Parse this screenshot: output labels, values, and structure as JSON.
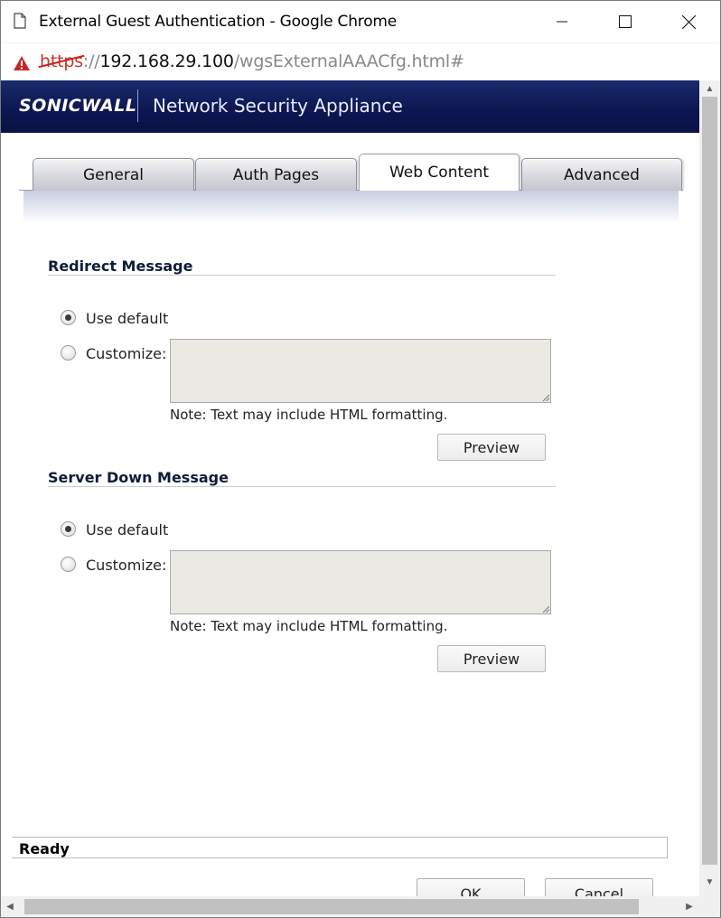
{
  "window": {
    "title": "External Guest Authentication - Google Chrome",
    "controls": [
      "minimize",
      "maximize",
      "close"
    ]
  },
  "address": {
    "scheme": "https",
    "separator": "://",
    "host": "192.168.29.100",
    "path": "/wgsExternalAAACfg.html#",
    "security_state": "not-secure-warning"
  },
  "banner": {
    "logo": "SONICWALL",
    "product": "Network Security Appliance",
    "colors": {
      "banner_bg": "#0c1650",
      "title_text": "#0e1c3a"
    }
  },
  "tabs": [
    {
      "label": "General",
      "active": false
    },
    {
      "label": "Auth Pages",
      "active": false
    },
    {
      "label": "Web Content",
      "active": true
    },
    {
      "label": "Advanced",
      "active": false
    }
  ],
  "redirect": {
    "title": "Redirect Message",
    "option_default": "Use default",
    "option_custom": "Customize:",
    "selected": "default",
    "custom_value": "",
    "note": "Note: Text may include HTML formatting.",
    "preview_label": "Preview"
  },
  "server_down": {
    "title": "Server Down Message",
    "option_default": "Use default",
    "option_custom": "Customize:",
    "selected": "default",
    "custom_value": "",
    "note": "Note: Text may include HTML formatting.",
    "preview_label": "Preview"
  },
  "status": {
    "text": "Ready"
  },
  "footer": {
    "ok_label": "OK",
    "cancel_label": "Cancel"
  }
}
